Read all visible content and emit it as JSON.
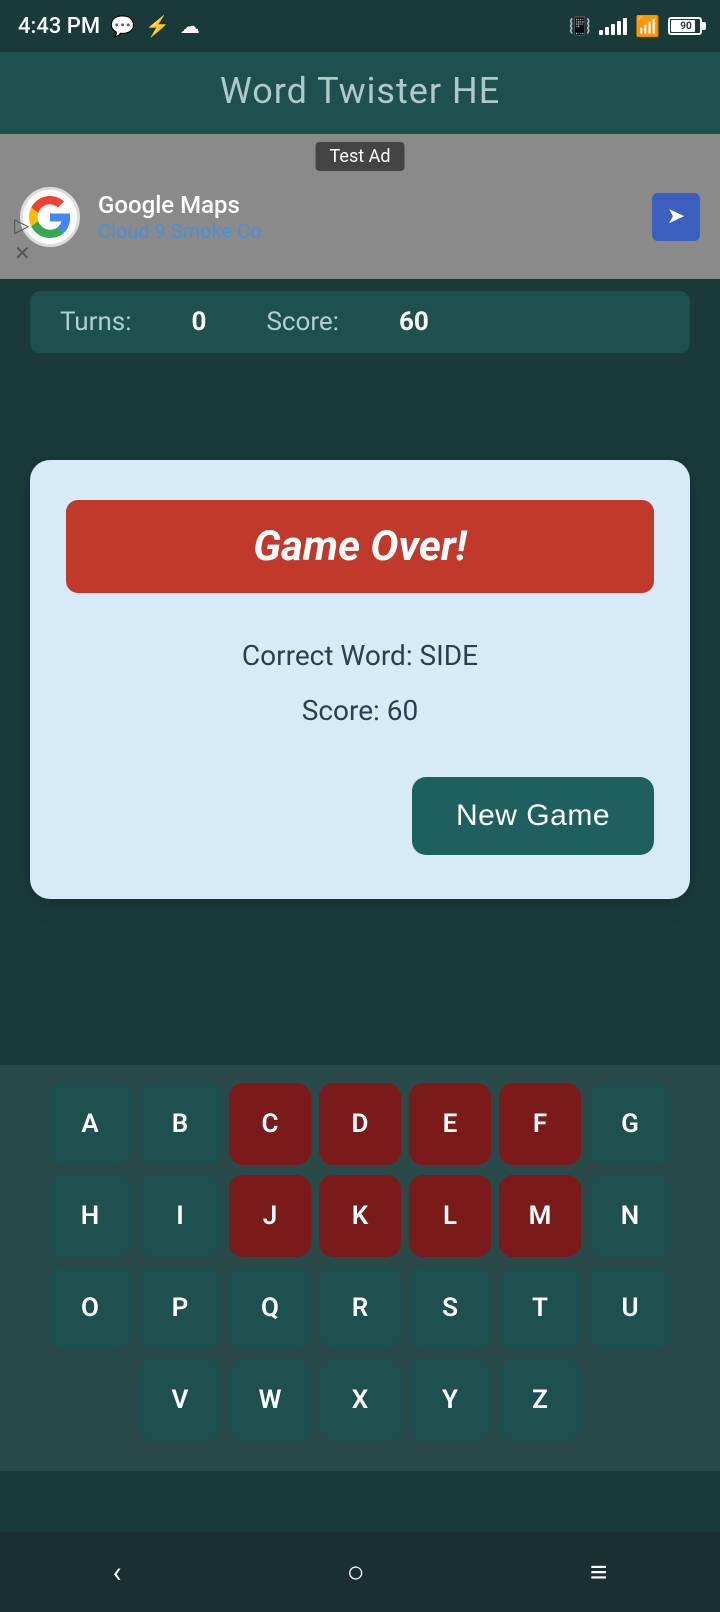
{
  "statusBar": {
    "time": "4:43 PM",
    "battery": "90"
  },
  "header": {
    "title": "Word Twister HE"
  },
  "ad": {
    "label": "Test Ad",
    "company": "Google Maps",
    "subtitle": "Cloud 9 Smoke Co."
  },
  "scoreBar": {
    "turnsLabel": "Turns:",
    "turnsValue": "0",
    "scoreLabel": "Score:",
    "scoreValue": "60"
  },
  "modal": {
    "gameOverText": "Game Over!",
    "correctWordLabel": "Correct Word: SIDE",
    "scoreLabel": "Score: 60",
    "newGameButton": "New Game"
  },
  "keyboard": {
    "rows": [
      [
        "A",
        "B",
        "C",
        "D",
        "E",
        "F",
        "G"
      ],
      [
        "H",
        "I",
        "J",
        "K",
        "L",
        "M",
        "N"
      ],
      [
        "O",
        "P",
        "Q",
        "R",
        "S",
        "T",
        "U"
      ],
      [
        "V",
        "W",
        "X",
        "Y",
        "Z"
      ]
    ],
    "usedKeys": [
      "C",
      "D",
      "E",
      "F",
      "J",
      "K",
      "L",
      "M"
    ]
  },
  "navBar": {
    "back": "‹",
    "home": "○",
    "menu": "≡"
  }
}
